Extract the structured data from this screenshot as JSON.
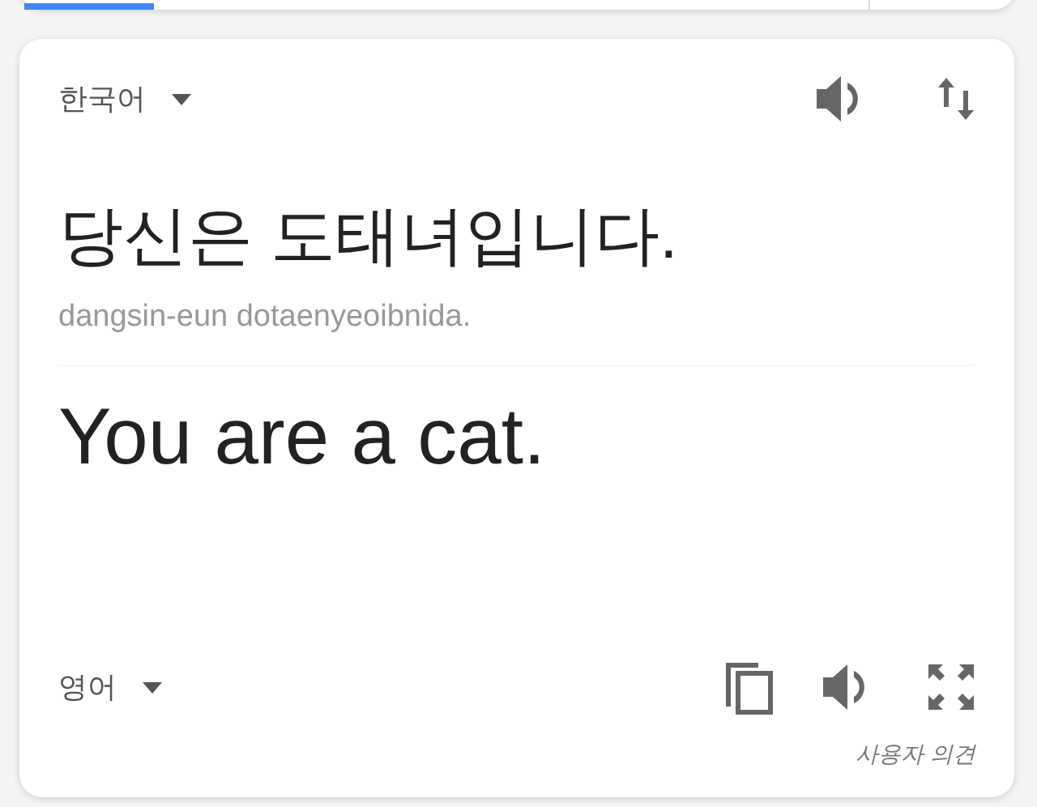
{
  "source": {
    "language": "한국어",
    "text": "당신은 도태녀입니다.",
    "romanization": "dangsin-eun dotaenyeoibnida."
  },
  "translation": {
    "text": "You are a cat.",
    "language": "영어"
  },
  "feedback": "사용자 의견"
}
